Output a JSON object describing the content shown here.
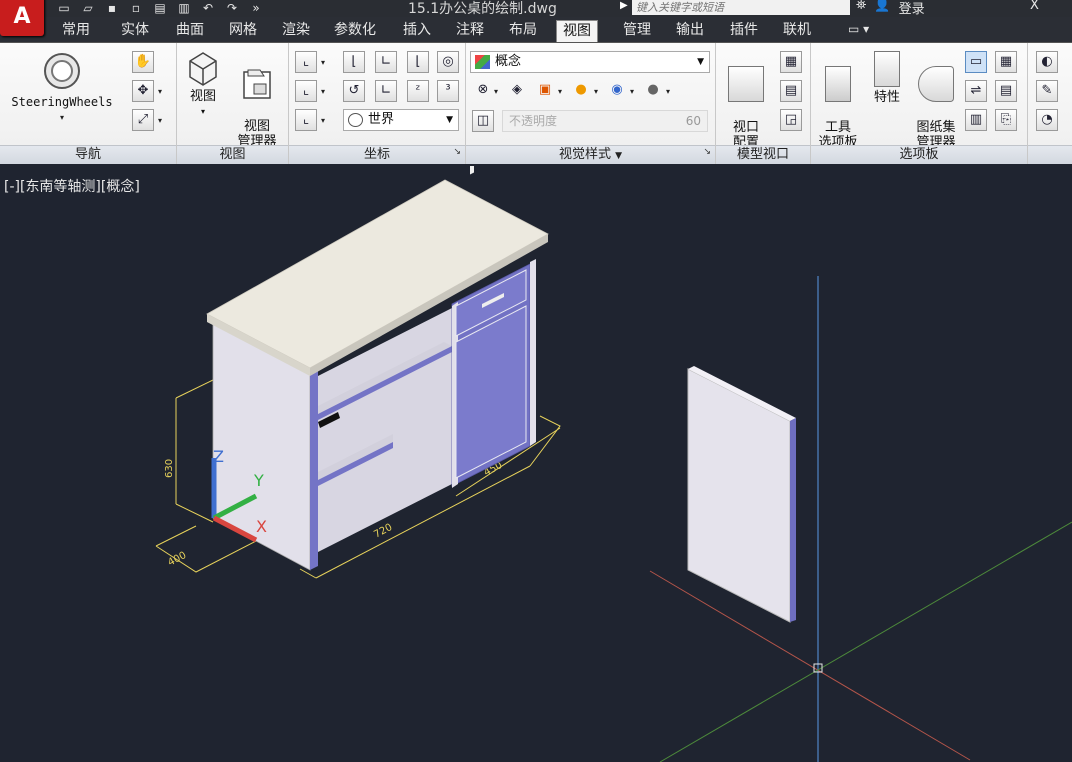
{
  "titlebar": {
    "app_logo": "A",
    "file_title": "15.1办公桌的绘制.dwg",
    "search_placeholder": "键入关键字或短语",
    "login_label": "登录",
    "far_right": "X"
  },
  "tabs": [
    "常用",
    "实体",
    "曲面",
    "网格",
    "渲染",
    "参数化",
    "插入",
    "注释",
    "布局",
    "视图",
    "管理",
    "输出",
    "插件",
    "联机"
  ],
  "active_tab": "视图",
  "ribbon": {
    "navigation": {
      "title": "导航",
      "steering_label": "SteeringWheels"
    },
    "views": {
      "title": "视图",
      "view_label": "视图",
      "view_manager_label": "视图\n管理器"
    },
    "coordinates": {
      "title": "坐标",
      "world_combo": "世界"
    },
    "visual_styles": {
      "title": "视觉样式",
      "style_combo": "概念",
      "opacity_label": "不透明度",
      "opacity_value": "60"
    },
    "model_viewports": {
      "title": "模型视口",
      "viewport_config_label": "视口\n配置"
    },
    "palettes": {
      "title": "选项板",
      "tool_palettes_label": "工具\n选项板",
      "properties_label": "特性",
      "sheet_set_label": "图纸集\n管理器"
    }
  },
  "viewport": {
    "label": "[-][东南等轴测][概念]",
    "dims": {
      "height": "630",
      "width": "720",
      "depth": "450",
      "side": "400"
    },
    "ucs": {
      "x": "X",
      "y": "Y",
      "z": "Z"
    }
  },
  "colors": {
    "background": "#1f2430",
    "desk_top": "#ece9df",
    "desk_side": "#e0dee8",
    "drawer_blue": "#7272c4",
    "dim_yellow": "#e7d25b",
    "axis_x": "#d9463f",
    "axis_y": "#33b044",
    "axis_z": "#3f6fd0"
  }
}
